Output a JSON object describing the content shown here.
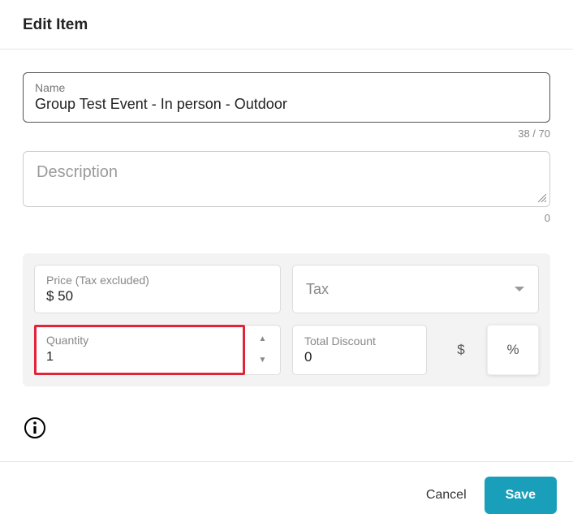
{
  "header": {
    "title": "Edit Item"
  },
  "name": {
    "label": "Name",
    "value": "Group Test Event - In person - Outdoor",
    "counter": "38 / 70"
  },
  "description": {
    "placeholder": "Description",
    "counter": "0"
  },
  "price": {
    "label": "Price (Tax excluded)",
    "value": "$ 50"
  },
  "tax": {
    "label": "Tax"
  },
  "quantity": {
    "label": "Quantity",
    "value": "1"
  },
  "discount": {
    "label": "Total Discount",
    "value": "0",
    "toggle_currency": "$",
    "toggle_percent": "%"
  },
  "footer": {
    "cancel": "Cancel",
    "save": "Save"
  }
}
